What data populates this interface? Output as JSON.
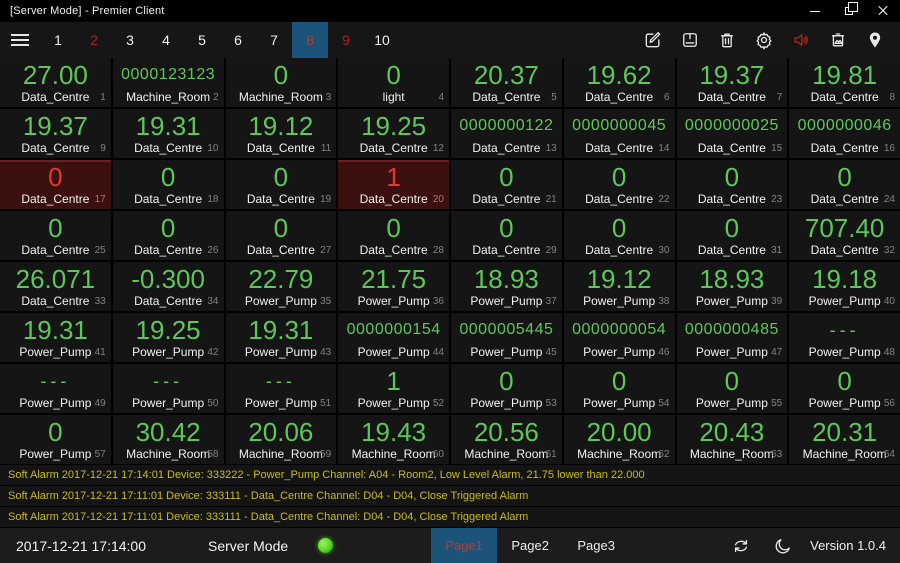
{
  "colors": {
    "accent_blue": "#1b5379",
    "value_green": "#5ec75a",
    "alarm_red": "#e03a30",
    "alarm_cell_bg": "#3d1010",
    "alarm_text": "#c9bb1e",
    "tab_alert_red": "#a82525",
    "led_green": "#52d726"
  },
  "window": {
    "title": "[Server Mode] - Premier Client",
    "controls": [
      "minimize",
      "restore",
      "close"
    ]
  },
  "toolbar": {
    "tabs": [
      {
        "label": "1"
      },
      {
        "label": "2",
        "state": "alert"
      },
      {
        "label": "3"
      },
      {
        "label": "4"
      },
      {
        "label": "5"
      },
      {
        "label": "6"
      },
      {
        "label": "7"
      },
      {
        "label": "8",
        "state": "selected"
      },
      {
        "label": "9",
        "state": "alert"
      },
      {
        "label": "10"
      }
    ],
    "icons": [
      "menu-icon",
      "edit-icon",
      "save-icon",
      "trash-icon",
      "gear-icon",
      "speaker-icon",
      "snapshot-icon",
      "location-pin-icon"
    ]
  },
  "grid": {
    "cells": [
      {
        "value": "27.00",
        "label": "Data_Centre",
        "idx": "1"
      },
      {
        "value": "0000123123",
        "label": "Machine_Room",
        "idx": "2"
      },
      {
        "value": "0",
        "label": "Machine_Room",
        "idx": "3"
      },
      {
        "value": "0",
        "label": "light",
        "idx": "4"
      },
      {
        "value": "20.37",
        "label": "Data_Centre",
        "idx": "5"
      },
      {
        "value": "19.62",
        "label": "Data_Centre",
        "idx": "6"
      },
      {
        "value": "19.37",
        "label": "Data_Centre",
        "idx": "7"
      },
      {
        "value": "19.81",
        "label": "Data_Centre",
        "idx": "8"
      },
      {
        "value": "19.37",
        "label": "Data_Centre",
        "idx": "9"
      },
      {
        "value": "19.31",
        "label": "Data_Centre",
        "idx": "10"
      },
      {
        "value": "19.12",
        "label": "Data_Centre",
        "idx": "11"
      },
      {
        "value": "19.25",
        "label": "Data_Centre",
        "idx": "12"
      },
      {
        "value": "0000000122",
        "label": "Data_Centre",
        "idx": "13"
      },
      {
        "value": "0000000045",
        "label": "Data_Centre",
        "idx": "14"
      },
      {
        "value": "0000000025",
        "label": "Data_Centre",
        "idx": "15"
      },
      {
        "value": "0000000046",
        "label": "Data_Centre",
        "idx": "16"
      },
      {
        "value": "0",
        "label": "Data_Centre",
        "idx": "17",
        "state": "alarm"
      },
      {
        "value": "0",
        "label": "Data_Centre",
        "idx": "18"
      },
      {
        "value": "0",
        "label": "Data_Centre",
        "idx": "19"
      },
      {
        "value": "1",
        "label": "Data_Centre",
        "idx": "20",
        "state": "alarm"
      },
      {
        "value": "0",
        "label": "Data_Centre",
        "idx": "21"
      },
      {
        "value": "0",
        "label": "Data_Centre",
        "idx": "22"
      },
      {
        "value": "0",
        "label": "Data_Centre",
        "idx": "23"
      },
      {
        "value": "0",
        "label": "Data_Centre",
        "idx": "24"
      },
      {
        "value": "0",
        "label": "Data_Centre",
        "idx": "25"
      },
      {
        "value": "0",
        "label": "Data_Centre",
        "idx": "26"
      },
      {
        "value": "0",
        "label": "Data_Centre",
        "idx": "27"
      },
      {
        "value": "0",
        "label": "Data_Centre",
        "idx": "28"
      },
      {
        "value": "0",
        "label": "Data_Centre",
        "idx": "29"
      },
      {
        "value": "0",
        "label": "Data_Centre",
        "idx": "30"
      },
      {
        "value": "0",
        "label": "Data_Centre",
        "idx": "31"
      },
      {
        "value": "707.40",
        "label": "Data_Centre",
        "idx": "32"
      },
      {
        "value": "26.071",
        "label": "Data_Centre",
        "idx": "33"
      },
      {
        "value": "-0.300",
        "label": "Data_Centre",
        "idx": "34"
      },
      {
        "value": "22.79",
        "label": "Power_Pump",
        "idx": "35"
      },
      {
        "value": "21.75",
        "label": "Power_Pump",
        "idx": "36"
      },
      {
        "value": "18.93",
        "label": "Power_Pump",
        "idx": "37"
      },
      {
        "value": "19.12",
        "label": "Power_Pump",
        "idx": "38"
      },
      {
        "value": "18.93",
        "label": "Power_Pump",
        "idx": "39"
      },
      {
        "value": "19.18",
        "label": "Power_Pump",
        "idx": "40"
      },
      {
        "value": "19.31",
        "label": "Power_Pump",
        "idx": "41"
      },
      {
        "value": "19.25",
        "label": "Power_Pump",
        "idx": "42"
      },
      {
        "value": "19.31",
        "label": "Power_Pump",
        "idx": "43"
      },
      {
        "value": "0000000154",
        "label": "Power_Pump",
        "idx": "44"
      },
      {
        "value": "0000005445",
        "label": "Power_Pump",
        "idx": "45"
      },
      {
        "value": "0000000054",
        "label": "Power_Pump",
        "idx": "46"
      },
      {
        "value": "0000000485",
        "label": "Power_Pump",
        "idx": "47"
      },
      {
        "value": "---",
        "label": "Power_Pump",
        "idx": "48"
      },
      {
        "value": "---",
        "label": "Power_Pump",
        "idx": "49"
      },
      {
        "value": "---",
        "label": "Power_Pump",
        "idx": "50"
      },
      {
        "value": "---",
        "label": "Power_Pump",
        "idx": "51"
      },
      {
        "value": "1",
        "label": "Power_Pump",
        "idx": "52"
      },
      {
        "value": "0",
        "label": "Power_Pump",
        "idx": "53"
      },
      {
        "value": "0",
        "label": "Power_Pump",
        "idx": "54"
      },
      {
        "value": "0",
        "label": "Power_Pump",
        "idx": "55"
      },
      {
        "value": "0",
        "label": "Power_Pump",
        "idx": "56"
      },
      {
        "value": "0",
        "label": "Power_Pump",
        "idx": "57"
      },
      {
        "value": "30.42",
        "label": "Machine_Room",
        "idx": "58"
      },
      {
        "value": "20.06",
        "label": "Machine_Room",
        "idx": "59"
      },
      {
        "value": "19.43",
        "label": "Machine_Room",
        "idx": "60"
      },
      {
        "value": "20.56",
        "label": "Machine_Room",
        "idx": "61"
      },
      {
        "value": "20.00",
        "label": "Machine_Room",
        "idx": "62"
      },
      {
        "value": "20.43",
        "label": "Machine_Room",
        "idx": "63"
      },
      {
        "value": "20.31",
        "label": "Machine_Room",
        "idx": "64"
      }
    ]
  },
  "alarms": [
    "Soft Alarm 2017-12-21 17:14:01 Device: 333222 - Power_Pump Channel: A04 - Room2, Low Level Alarm, 21.75 lower than 22.000",
    "Soft Alarm 2017-12-21 17:11:01 Device: 333111 - Data_Centre Channel: D04 - D04, Close Triggered Alarm",
    "Soft Alarm 2017-12-21 17:11:01 Device: 333111 - Data_Centre Channel: D04 - D04, Close Triggered Alarm"
  ],
  "statusbar": {
    "time": "2017-12-21 17:14:00",
    "mode_label": "Server Mode",
    "pages": [
      {
        "label": "Page1",
        "state": "selected"
      },
      {
        "label": "Page2"
      },
      {
        "label": "Page3"
      }
    ],
    "icons": [
      "sync-icon",
      "moon-icon"
    ],
    "version": "Version 1.0.4"
  }
}
